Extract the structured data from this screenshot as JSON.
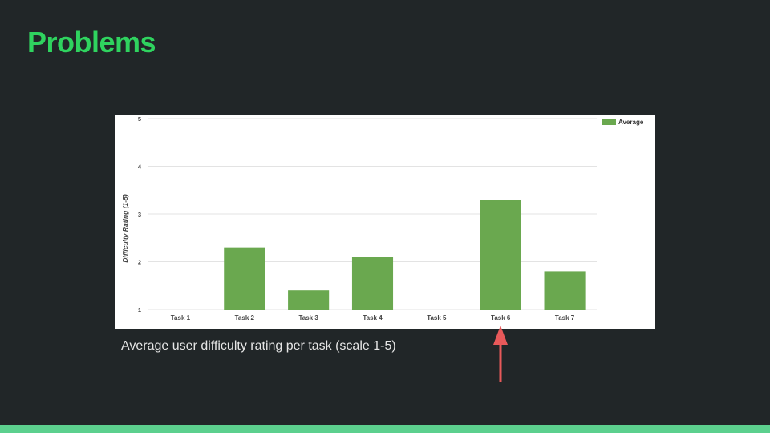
{
  "slide": {
    "title": "Problems",
    "caption": "Average user difficulty rating per task (scale 1-5)"
  },
  "colors": {
    "title": "#2fd35f",
    "bar": "#6aa84f",
    "arrow": "#e8595a",
    "accent_bar": "#5cd08e",
    "background": "#212628"
  },
  "annotation": {
    "arrow_target": "Task 6",
    "icon": "up-arrow-icon"
  },
  "chart_data": {
    "type": "bar",
    "categories": [
      "Task 1",
      "Task 2",
      "Task 3",
      "Task 4",
      "Task 5",
      "Task 6",
      "Task 7"
    ],
    "series": [
      {
        "name": "Average",
        "values": [
          1.0,
          2.3,
          1.4,
          2.1,
          1.0,
          3.3,
          1.8
        ]
      }
    ],
    "ylabel": "Difficulty Rating (1-5)",
    "ylim": [
      1,
      5
    ],
    "yticks": [
      "1",
      "2",
      "3",
      "4",
      "5"
    ],
    "grid": true,
    "legend": "top-right"
  }
}
